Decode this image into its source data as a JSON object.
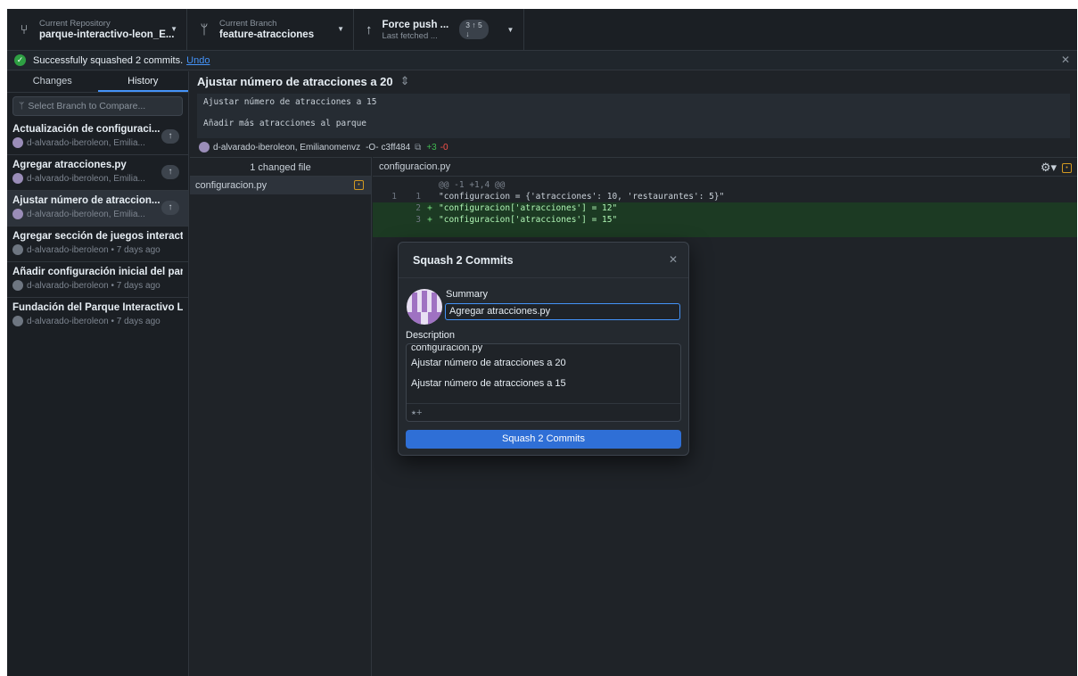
{
  "toolbar": {
    "repo": {
      "caption": "Current Repository",
      "name": "parque-interactivo-leon_E..."
    },
    "branch": {
      "caption": "Current Branch",
      "name": "feature-atracciones"
    },
    "push": {
      "title": "Force push ...",
      "subtitle": "Last fetched ...",
      "badge": "3 ↑ 5 ↓"
    }
  },
  "banner": {
    "message": "Successfully squashed 2 commits.",
    "link": "Undo",
    "close": "✕"
  },
  "sidebar": {
    "tabs": [
      "Changes",
      "History"
    ],
    "compare_placeholder": "Select Branch to Compare...",
    "commits": [
      {
        "title": "Actualización de configuraci...",
        "meta": "d-alvarado-iberoleon, Emilia...",
        "push": "↑"
      },
      {
        "title": "Agregar atracciones.py",
        "meta": "d-alvarado-iberoleon, Emilia...",
        "push": "↑"
      },
      {
        "title": "Ajustar número de atraccion...",
        "meta": "d-alvarado-iberoleon, Emilia...",
        "push": "↑"
      },
      {
        "title": "Agregar sección de juegos interacti...",
        "meta": "d-alvarado-iberoleon • 7 days ago"
      },
      {
        "title": "Añadir configuración inicial del parq...",
        "meta": "d-alvarado-iberoleon • 7 days ago"
      },
      {
        "title": "Fundación del Parque Interactivo Le...",
        "meta": "d-alvarado-iberoleon • 7 days ago"
      }
    ]
  },
  "commit": {
    "title": "Ajustar número de atracciones a 20",
    "description": [
      "Ajustar número de atracciones a 15",
      "",
      "Añadir más atracciones al parque"
    ],
    "authors": "d-alvarado-iberoleon, Emilianomenvz",
    "sha": "c3ff484",
    "additions": "+3",
    "deletions": "-0"
  },
  "files": {
    "header": "1 changed file",
    "items": [
      "configuracion.py"
    ]
  },
  "diff": {
    "file": "configuracion.py",
    "hunk": "@@ -1 +1,4 @@",
    "lines": [
      {
        "old": "1",
        "new": "1",
        "sign": " ",
        "text": "\"configuracion = {'atracciones': 10, 'restaurantes': 5}\""
      },
      {
        "old": "",
        "new": "2",
        "sign": "+",
        "text": "\"configuracion['atracciones'] = 12\""
      },
      {
        "old": "",
        "new": "3",
        "sign": "+",
        "text": "\"configuracion['atracciones'] = 15\""
      }
    ]
  },
  "modal": {
    "title": "Squash 2 Commits",
    "close": "✕",
    "summary_label": "Summary",
    "summary_value": "Agregar atracciones.py",
    "description_label": "Description",
    "description_lines": [
      "configuracion.py",
      "Ajustar número de atracciones a 20",
      "Ajustar número de atracciones a 15"
    ],
    "coauthor_icon": "add-coauthor-icon",
    "button": "Squash 2 Commits"
  },
  "colors": {
    "accent": "#4493f8",
    "success": "#2ea043",
    "added": "#1c3a23",
    "button": "#2f6fd6"
  }
}
